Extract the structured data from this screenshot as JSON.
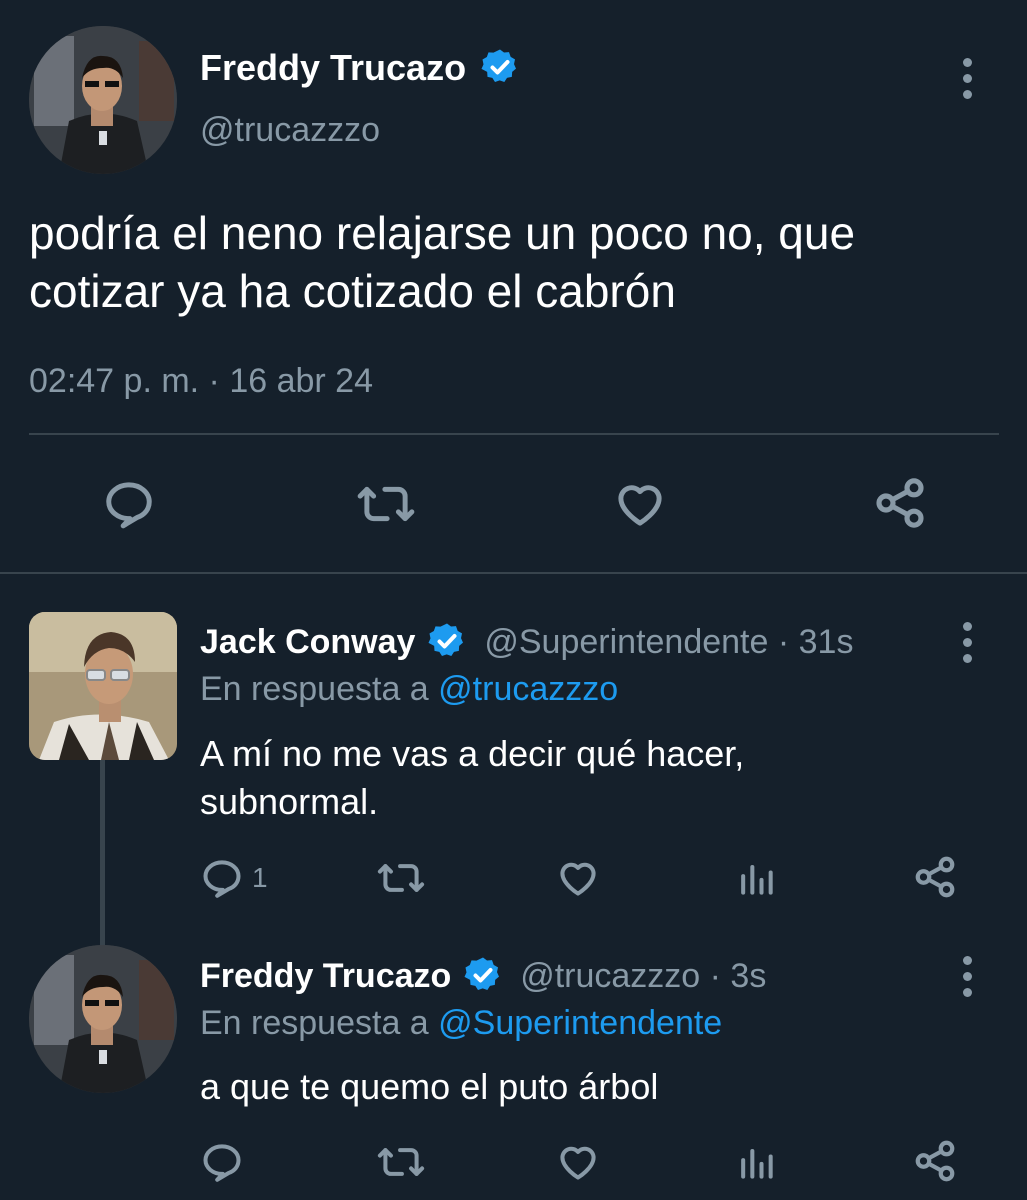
{
  "main_tweet": {
    "author_name": "Freddy Trucazo",
    "handle": "@trucazzzo",
    "text_line1": "podría el neno relajarse un poco no, que",
    "text_line2": "cotizar ya ha cotizado el cabrón",
    "timestamp": "02:47 p. m. · 16 abr 24",
    "actions": [
      "reply-icon",
      "retweet-icon",
      "like-icon",
      "share-icon"
    ]
  },
  "reply1": {
    "author_name": "Jack Conway",
    "meta": "@Superintendente · 31s",
    "reply_prefix": "En respuesta a",
    "reply_to": "@trucazzzo",
    "text_line1": "A mí no me vas a decir qué hacer,",
    "text_line2": "subnormal.",
    "reply_count": "1"
  },
  "reply2": {
    "author_name": "Freddy Trucazo",
    "meta": "@trucazzzo · 3s",
    "reply_prefix": "En respuesta a",
    "reply_to": "@Superintendente",
    "text": "a que te quemo el puto árbol"
  },
  "colors": {
    "background": "#15202b",
    "muted": "#8899a6",
    "accent": "#1d9bf0",
    "divider": "#38444d"
  }
}
